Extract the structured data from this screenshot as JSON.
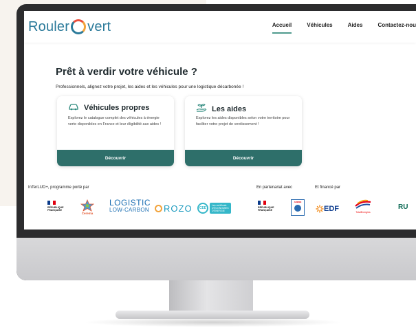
{
  "header": {
    "logo_left": "Rouler",
    "logo_right": "vert",
    "nav": [
      {
        "label": "Accueil",
        "active": true
      },
      {
        "label": "Véhicules",
        "active": false
      },
      {
        "label": "Aides",
        "active": false
      },
      {
        "label": "Contactez-nou",
        "active": false
      }
    ]
  },
  "hero": {
    "title": "Prêt à verdir votre véhicule ?",
    "subtitle": "Professionnels, alignez votre projet, les aides et les véhicules pour une logistique décarbonée !"
  },
  "cards": [
    {
      "icon": "car-icon",
      "title": "Véhicules propres",
      "text": "Explorez le catalogue complet des véhicules à énergie verte disponibles en France et leur éligibilité aux aides !",
      "button": "Découvrir"
    },
    {
      "icon": "sprout-hand-icon",
      "title": "Les aides",
      "text": "Explorez les aides disponibles selon votre territoire pour faciliter votre projet de verdissement !",
      "button": "Découvrir"
    }
  ],
  "partners": {
    "label_program": "InTerLUD+, programme porté par",
    "label_partner": "En partenariat avec",
    "label_funded": "Et financé par",
    "rf1_line1": "RÉPUBLIQUE",
    "rf1_line2": "FRANÇAISE",
    "cerema": "Cerema",
    "logistic_line1": "LOGISTIC",
    "logistic_line2": "LOW-CARBON",
    "rozo": "ROZO",
    "cee_badge": "CEE",
    "cee_tag_line1": "Les certificats",
    "cee_tag_line2": "D'ÉCONOMIES",
    "cee_tag_line3": "D'ÉNERGIE",
    "rf2_line1": "RÉPUBLIQUE",
    "rf2_line2": "FRANÇAISE",
    "ademe": "ADEME",
    "edf": "EDF",
    "totalenergies": "TotalEnergies",
    "rul": "RU"
  },
  "colors": {
    "brand_teal": "#2e6f6a",
    "logo_blue": "#2b7a9a",
    "nav_active": "#4e9a8d"
  }
}
